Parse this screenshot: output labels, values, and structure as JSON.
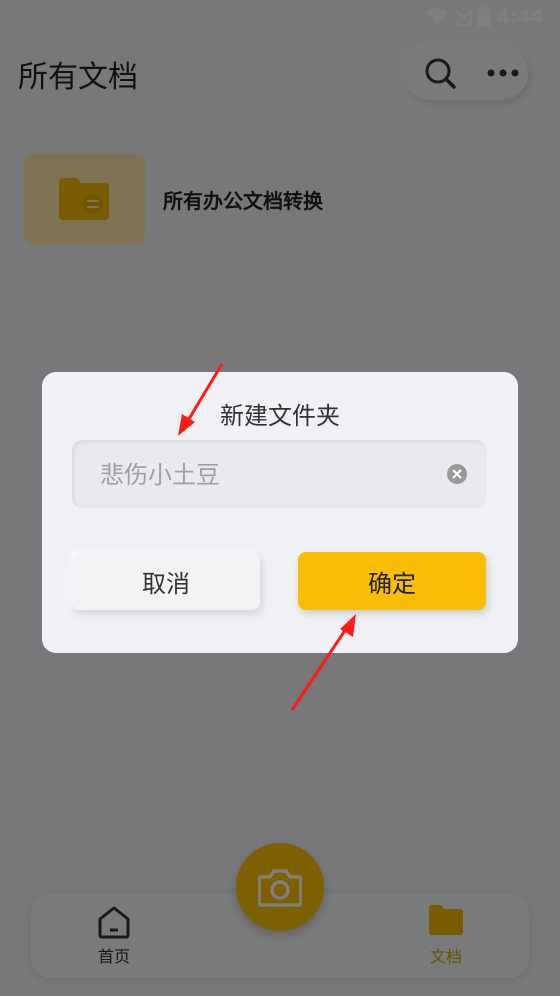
{
  "status_bar": {
    "time": "4:44"
  },
  "header": {
    "title": "所有文档"
  },
  "folders": [
    {
      "label": "所有办公文档转换"
    }
  ],
  "bottom_nav": {
    "home_label": "首页",
    "docs_label": "文档"
  },
  "dialog": {
    "title": "新建文件夹",
    "input_placeholder": "悲伤小土豆",
    "cancel_label": "取消",
    "confirm_label": "确定"
  },
  "colors": {
    "accent": "#f8bd05",
    "annotation_arrow": "#ff1a1a"
  }
}
